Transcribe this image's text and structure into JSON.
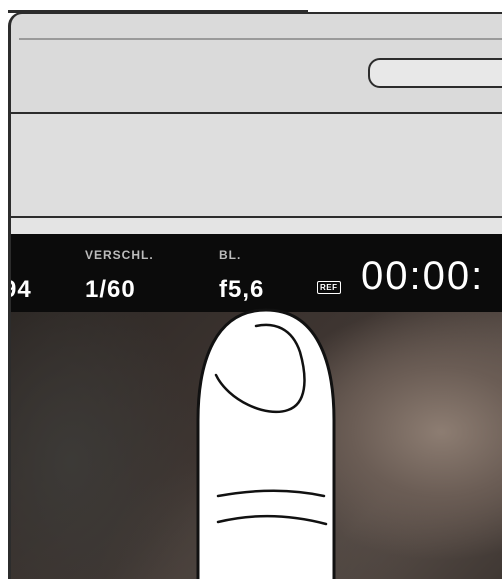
{
  "hud": {
    "fps_partial": "94",
    "shutter_label": "VERSCHL.",
    "shutter_value": "1/60",
    "iris_label": "BL.",
    "iris_value": "f5,6",
    "ref_badge": "REF",
    "timecode_partial": "00:00:"
  },
  "colors": {
    "hud_background": "#0b0b0b",
    "hud_text": "#ffffff",
    "hud_label": "#bcbcbc",
    "device_body": "#dadada"
  },
  "icons": {
    "finger": "finger-touch-icon",
    "ref": "ref-badge-icon"
  }
}
